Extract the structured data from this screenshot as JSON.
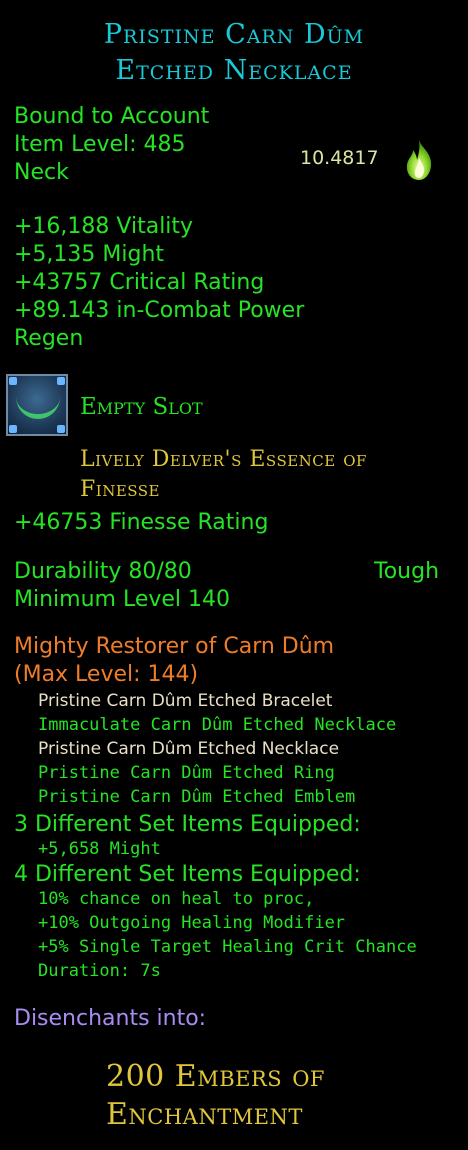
{
  "title": {
    "line1": "Pristine Carn Dûm",
    "line2": "Etched Necklace"
  },
  "info": {
    "bound": "Bound to Account",
    "item_level": "Item Level: 485",
    "slot": "Neck",
    "value": "10.4817",
    "value_icon": "flame-icon"
  },
  "stats": [
    "+16,188 Vitality",
    "+5,135 Might",
    "+43757 Critical Rating",
    "+89.143 in-Combat Power",
    "Regen"
  ],
  "essence_slot": {
    "icon": "essence-slot-icon",
    "label": "Empty Slot",
    "essence_line1": "Lively Delver's Essence of",
    "essence_line2": "Finesse",
    "essence_stat": "+46753 Finesse Rating"
  },
  "durability": {
    "text": "Durability 80/80",
    "type": "Tough",
    "min_level": "Minimum Level 140"
  },
  "set": {
    "name": "Mighty Restorer of Carn Dûm",
    "max_level": "(Max Level: 144)",
    "items": [
      {
        "name": "Pristine Carn Dûm Etched Bracelet",
        "equipped": false
      },
      {
        "name": "Immaculate Carn Dûm Etched Necklace",
        "equipped": true
      },
      {
        "name": "Pristine Carn Dûm Etched Necklace",
        "equipped": false
      },
      {
        "name": "Pristine Carn Dûm Etched Ring",
        "equipped": true
      },
      {
        "name": "Pristine Carn Dûm Etched Emblem",
        "equipped": true
      }
    ],
    "bonus3_header": "3 Different Set Items Equipped:",
    "bonus3_lines": [
      "+5,658 Might"
    ],
    "bonus4_header": "4 Different Set Items Equipped:",
    "bonus4_lines": [
      "10% chance on heal to proc,",
      "+10% Outgoing Healing Modifier",
      "+5% Single Target Healing Crit Chance",
      "Duration: 7s"
    ]
  },
  "disenchant": {
    "label": "Disenchants into:",
    "line1": "200 Embers of",
    "line2": "Enchantment"
  },
  "colors": {
    "title": "#18c9d8",
    "stat": "#26e326",
    "essence": "#e0c63a",
    "set_name": "#ee7d2a",
    "disenchant": "#a98cf2"
  }
}
